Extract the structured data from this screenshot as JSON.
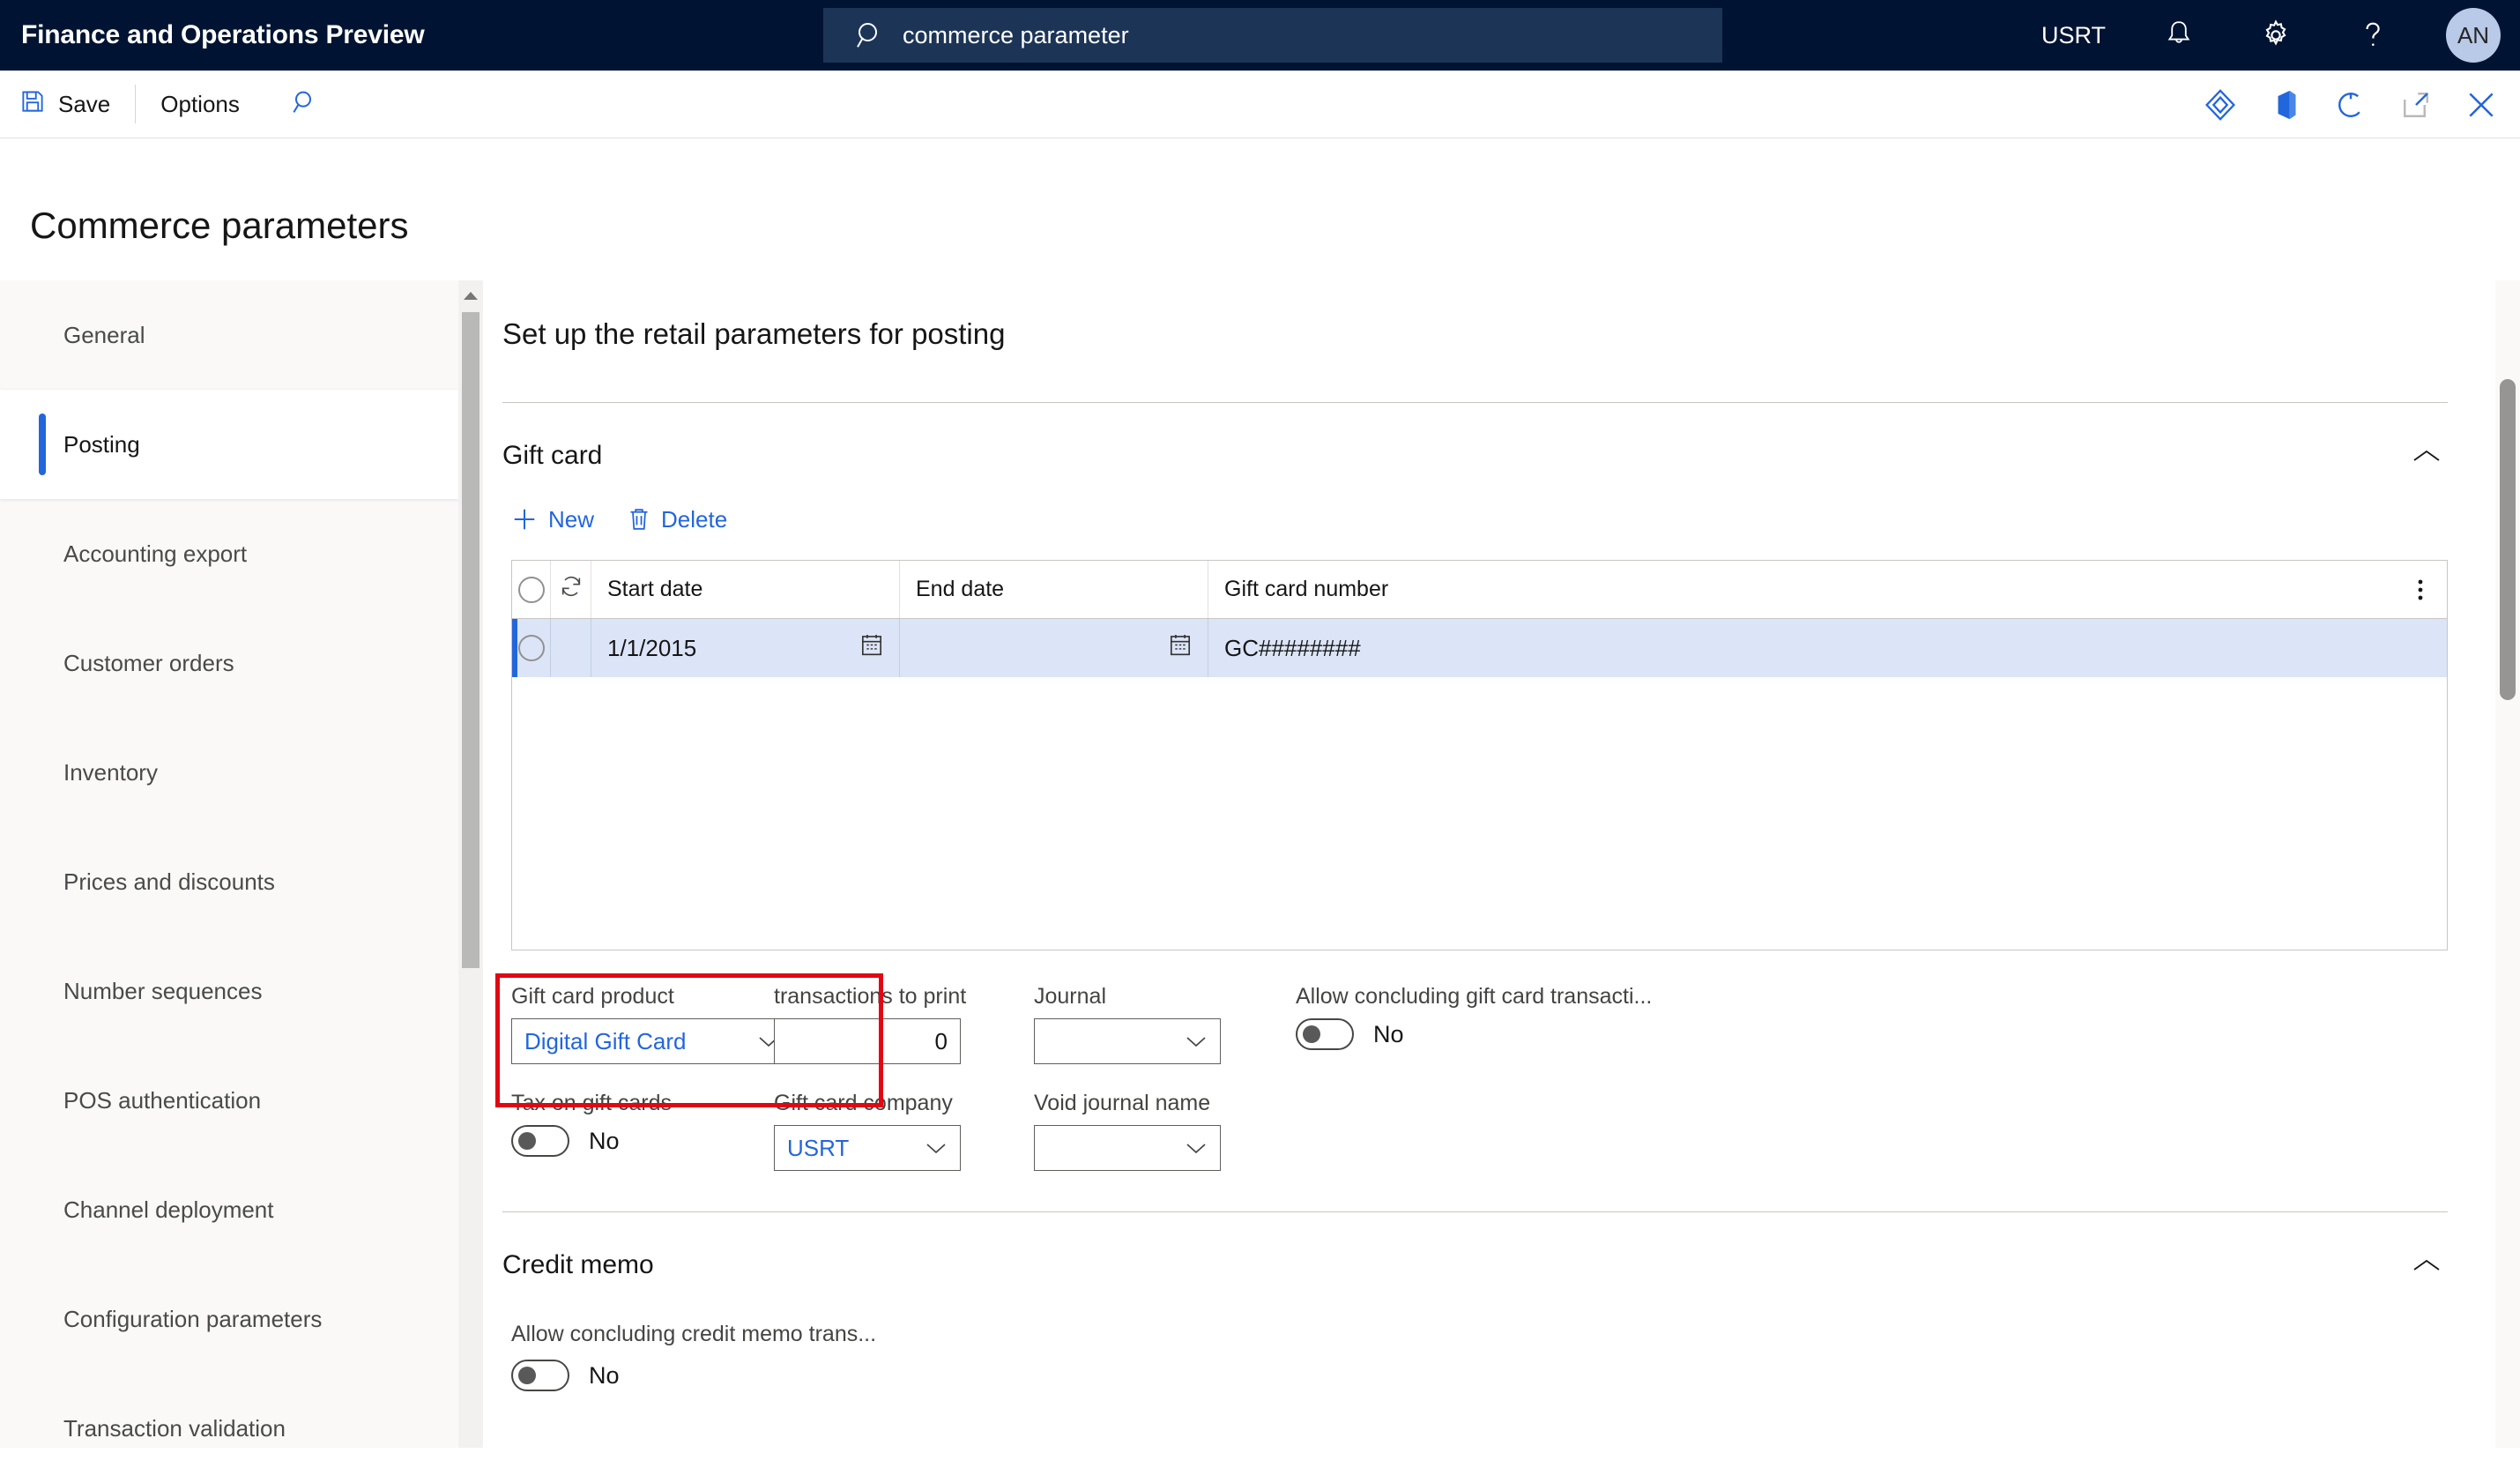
{
  "topbar": {
    "app_title": "Finance and Operations Preview",
    "search": {
      "value": "commerce parameter",
      "icon": "search-icon"
    },
    "company": "USRT",
    "icons": [
      "notifications-bell-icon",
      "settings-gear-icon",
      "help-question-icon"
    ],
    "avatar_initials": "AN"
  },
  "commandbar": {
    "save_label": "Save",
    "options_label": "Options",
    "find_icon": "search-icon",
    "right_icons": [
      "personalize-diamond-icon",
      "office-app-icon",
      "refresh-icon",
      "open-in-new-window-icon",
      "close-icon"
    ]
  },
  "page": {
    "title": "Commerce parameters"
  },
  "sidebar": {
    "items": [
      {
        "label": "General",
        "selected": false
      },
      {
        "label": "Posting",
        "selected": true
      },
      {
        "label": "Accounting export",
        "selected": false
      },
      {
        "label": "Customer orders",
        "selected": false
      },
      {
        "label": "Inventory",
        "selected": false
      },
      {
        "label": "Prices and discounts",
        "selected": false
      },
      {
        "label": "Number sequences",
        "selected": false
      },
      {
        "label": "POS authentication",
        "selected": false
      },
      {
        "label": "Channel deployment",
        "selected": false
      },
      {
        "label": "Configuration parameters",
        "selected": false
      },
      {
        "label": "Transaction validation",
        "selected": false
      }
    ]
  },
  "main": {
    "heading": "Set up the retail parameters for posting",
    "giftcard": {
      "group_title": "Gift card",
      "collapse_icon": "chevron-up-icon",
      "toolbar": {
        "new_label": "New",
        "new_icon": "plus-icon",
        "delete_label": "Delete",
        "delete_icon": "trash-icon"
      },
      "grid": {
        "columns": [
          "",
          "",
          "Start date",
          "End date",
          "Gift card number"
        ],
        "overflow_icon": "more-vertical-icon",
        "rows": [
          {
            "selected": true,
            "start_date": "1/1/2015",
            "end_date": "",
            "gift_card_number": "GC########",
            "start_date_icon": "calendar-icon",
            "end_date_icon": "calendar-icon"
          }
        ]
      },
      "fields": {
        "gift_card_product": {
          "label": "Gift card product",
          "value": "Digital Gift Card",
          "highlighted": true
        },
        "tax_on_gift_cards": {
          "label": "Tax on gift cards",
          "value": "No",
          "state": "off"
        },
        "transactions_to_print": {
          "label": "transactions to print",
          "value": "0"
        },
        "gift_card_company": {
          "label": "Gift card company",
          "value": "USRT"
        },
        "journal": {
          "label": "Journal",
          "value": ""
        },
        "void_journal_name": {
          "label": "Void journal name",
          "value": ""
        },
        "allow_concluding_gift_card": {
          "label": "Allow concluding gift card transacti...",
          "value": "No",
          "state": "off"
        }
      }
    },
    "creditmemo": {
      "group_title": "Credit memo",
      "collapse_icon": "chevron-up-icon",
      "allow_concluding_credit_memo": {
        "label": "Allow concluding credit memo trans...",
        "value": "No",
        "state": "off"
      }
    }
  },
  "colors": {
    "topbar_bg": "#001332",
    "accent": "#2266dd",
    "highlight": "#e30613",
    "row_selected": "#dce5f7"
  }
}
